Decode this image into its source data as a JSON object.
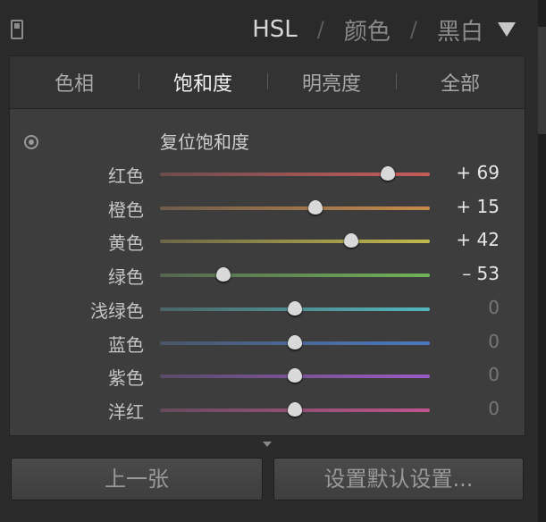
{
  "header": {
    "tabs": [
      "HSL",
      "颜色",
      "黑白"
    ],
    "separator": "/"
  },
  "subtabs": [
    "色相",
    "饱和度",
    "明亮度",
    "全部"
  ],
  "reset_label": "复位饱和度",
  "sliders": [
    {
      "label": "红色",
      "value": "+ 69",
      "level": 69,
      "colors": [
        "#6e4d4d",
        "#c75b5b"
      ]
    },
    {
      "label": "橙色",
      "value": "+ 15",
      "level": 15,
      "colors": [
        "#6e5c4a",
        "#c98a4b"
      ]
    },
    {
      "label": "黄色",
      "value": "+ 42",
      "level": 42,
      "colors": [
        "#6b6648",
        "#c2b94c"
      ]
    },
    {
      "label": "绿色",
      "value": "– 53",
      "level": -53,
      "colors": [
        "#556650",
        "#70b357"
      ]
    },
    {
      "label": "浅绿色",
      "value": "0",
      "level": 0,
      "colors": [
        "#4b6466",
        "#52b8be"
      ]
    },
    {
      "label": "蓝色",
      "value": "0",
      "level": 0,
      "colors": [
        "#4a566a",
        "#4a79c0"
      ]
    },
    {
      "label": "紫色",
      "value": "0",
      "level": 0,
      "colors": [
        "#5a4b6a",
        "#9b5bc4"
      ]
    },
    {
      "label": "洋红",
      "value": "0",
      "level": 0,
      "colors": [
        "#664b5c",
        "#c0548f"
      ]
    }
  ],
  "buttons": {
    "prev": "上一张",
    "set_default": "设置默认设置..."
  }
}
